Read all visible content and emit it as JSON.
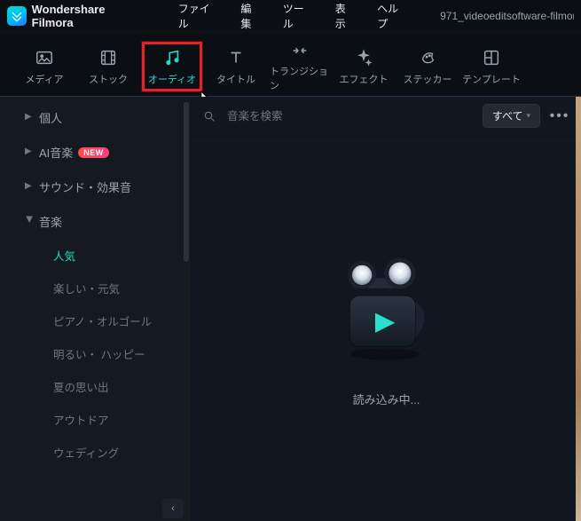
{
  "app": {
    "product_name": "Wondershare Filmora",
    "open_file_label": "971_videoeditsoftware-filmor"
  },
  "menubar": {
    "items": [
      "ファイル",
      "編集",
      "ツール",
      "表示",
      "ヘルプ"
    ]
  },
  "tool_tabs": {
    "items": [
      {
        "id": "media",
        "label": "メディア",
        "icon": "image-icon"
      },
      {
        "id": "stock",
        "label": "ストック",
        "icon": "film-icon"
      },
      {
        "id": "audio",
        "label": "オーディオ",
        "icon": "music-note-icon"
      },
      {
        "id": "titles",
        "label": "タイトル",
        "icon": "text-t-icon"
      },
      {
        "id": "transitions",
        "label": "トランジション",
        "icon": "transition-icon"
      },
      {
        "id": "effects",
        "label": "エフェクト",
        "icon": "sparkle-icon"
      },
      {
        "id": "stickers",
        "label": "ステッカー",
        "icon": "sticker-icon"
      },
      {
        "id": "templates",
        "label": "テンプレート",
        "icon": "layout-icon"
      }
    ],
    "active_id": "audio",
    "highlighted_id": "audio"
  },
  "sidebar": {
    "groups": [
      {
        "id": "personal",
        "label": "個人",
        "expandable": true,
        "expanded": false,
        "badge": null
      },
      {
        "id": "ai-music",
        "label": "AI音楽",
        "expandable": true,
        "expanded": false,
        "badge": "NEW"
      },
      {
        "id": "sfx",
        "label": "サウンド・効果音",
        "expandable": true,
        "expanded": false,
        "badge": null
      },
      {
        "id": "music",
        "label": "音楽",
        "expandable": true,
        "expanded": true,
        "badge": null
      }
    ],
    "music_subitems": [
      {
        "id": "popular",
        "label": "人気",
        "active": true
      },
      {
        "id": "fun",
        "label": "楽しい・元気",
        "active": false
      },
      {
        "id": "piano",
        "label": "ピアノ・オルゴール",
        "active": false
      },
      {
        "id": "bright",
        "label": "明るい・ ハッピー",
        "active": false
      },
      {
        "id": "summer",
        "label": "夏の思い出",
        "active": false
      },
      {
        "id": "outdoor",
        "label": "アウトドア",
        "active": false
      },
      {
        "id": "wedding",
        "label": "ウェディング",
        "active": false
      }
    ]
  },
  "main": {
    "search": {
      "placeholder": "音楽を検索"
    },
    "filter": {
      "label": "すべて"
    },
    "loading_label": "読み込み中..."
  },
  "colors": {
    "accent": "#27d6c5",
    "highlight_box": "#e42424"
  }
}
